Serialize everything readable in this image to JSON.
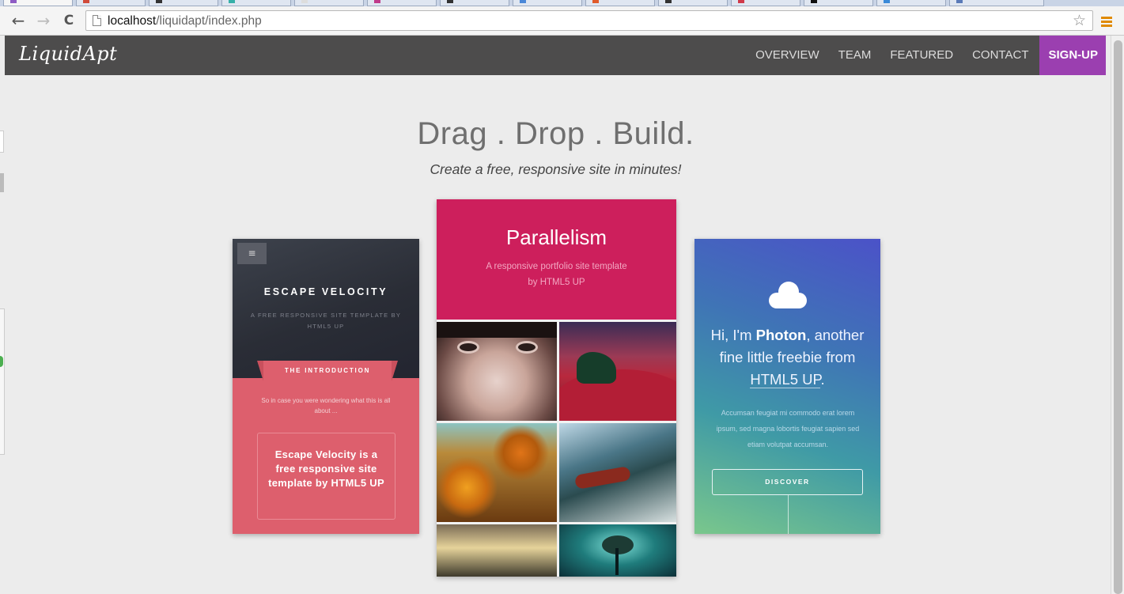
{
  "browser": {
    "url_host": "localhost",
    "url_path": "/liquidapt/index.php"
  },
  "site": {
    "logo": "LiquidApt",
    "nav": {
      "overview": "OVERVIEW",
      "team": "TEAM",
      "featured": "FEATURED",
      "contact": "CONTACT",
      "signup": "SIGN-UP"
    }
  },
  "hero": {
    "title": "Drag . Drop . Build.",
    "subtitle": "Create a free, responsive site in minutes!"
  },
  "templates": {
    "escape_velocity": {
      "menu_glyph": "≡",
      "title": "ESCAPE VELOCITY",
      "tagline": "A FREE RESPONSIVE SITE TEMPLATE BY HTML5 UP",
      "ribbon": "THE INTRODUCTION",
      "intro": "So in case you were wondering what this is all about ...",
      "box_text": "Escape Velocity is a free responsive site template by HTML5 UP"
    },
    "parallelism": {
      "title": "Parallelism",
      "subtitle": "A responsive portfolio site template by HTML5 UP"
    },
    "photon": {
      "heading_pre": "Hi, I'm ",
      "heading_name": "Photon",
      "heading_mid": ", another fine little freebie from ",
      "heading_link": "HTML5 UP",
      "heading_end": ".",
      "body": "Accumsan feugiat mi commodo erat lorem ipsum, sed magna lobortis feugiat sapien sed etiam volutpat accumsan.",
      "button": "DISCOVER"
    }
  },
  "colors": {
    "nav_bg": "#4d4c4c",
    "signup_bg": "#9b3fb0",
    "escape_velocity_accent": "#dd5f6d",
    "parallelism_accent": "#cd1f5c"
  }
}
